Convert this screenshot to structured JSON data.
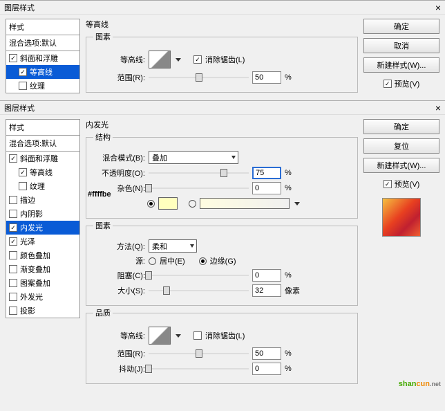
{
  "dlg1": {
    "title": "图层样式",
    "sectionTitle": "等高线",
    "fsElements": "图素",
    "left": {
      "header": "样式",
      "blendOpt": "混合选项:默认",
      "items": [
        {
          "label": "斜面和浮雕",
          "chk": true
        },
        {
          "label": "等高线",
          "chk": true,
          "sub": true,
          "sel": true
        },
        {
          "label": "纹理",
          "chk": false,
          "sub": true
        }
      ]
    },
    "contourLabel": "等高线:",
    "antiAlias": "消除锯齿(L)",
    "rangeLabel": "范围(R):",
    "rangeVal": "50",
    "pct": "%",
    "right": {
      "ok": "确定",
      "cancel": "取消",
      "newStyle": "新建样式(W)...",
      "preview": "预览(V)"
    }
  },
  "dlg2": {
    "title": "图层样式",
    "sectionTitle": "内发光",
    "left": {
      "header": "样式",
      "blendOpt": "混合选项:默认",
      "items": [
        {
          "label": "斜面和浮雕",
          "chk": true
        },
        {
          "label": "等高线",
          "chk": true,
          "sub": true
        },
        {
          "label": "纹理",
          "chk": false,
          "sub": true
        },
        {
          "label": "描边",
          "chk": false
        },
        {
          "label": "内阴影",
          "chk": false
        },
        {
          "label": "内发光",
          "chk": true,
          "sel": true
        },
        {
          "label": "光泽",
          "chk": true
        },
        {
          "label": "颜色叠加",
          "chk": false
        },
        {
          "label": "渐变叠加",
          "chk": false
        },
        {
          "label": "图案叠加",
          "chk": false
        },
        {
          "label": "外发光",
          "chk": false
        },
        {
          "label": "投影",
          "chk": false
        }
      ]
    },
    "struct": {
      "legend": "结构",
      "blendMode": "混合模式(B):",
      "blendVal": "叠加",
      "opacity": "不透明度(O):",
      "opacityVal": "75",
      "noise": "杂色(N):",
      "noiseVal": "0",
      "colorTag": "#ffffbe"
    },
    "elem": {
      "legend": "图素",
      "method": "方法(Q):",
      "methodVal": "柔和",
      "source": "源:",
      "center": "居中(E)",
      "edge": "边缘(G)",
      "choke": "阻塞(C):",
      "chokeVal": "0",
      "size": "大小(S):",
      "sizeVal": "32",
      "px": "像素"
    },
    "qual": {
      "legend": "品质",
      "contour": "等高线:",
      "anti": "消除锯齿(L)",
      "range": "范围(R):",
      "rangeVal": "50",
      "jitter": "抖动(J):",
      "jitterVal": "0"
    },
    "pct": "%",
    "right": {
      "ok": "确定",
      "reset": "复位",
      "newStyle": "新建样式(W)...",
      "preview": "预览(V)"
    }
  }
}
